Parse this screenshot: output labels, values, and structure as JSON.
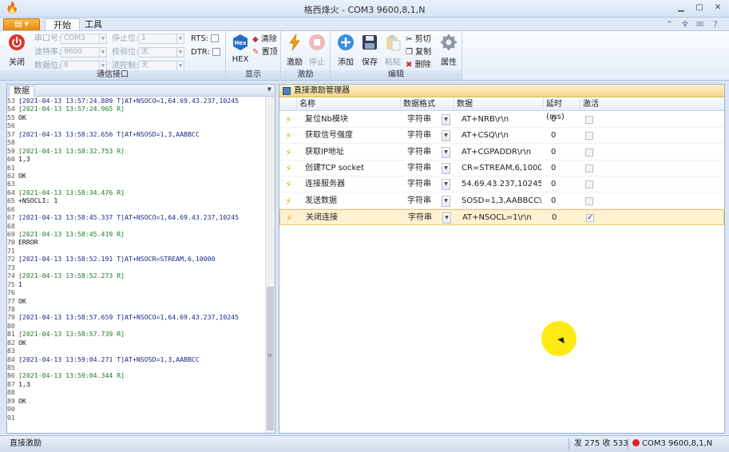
{
  "window": {
    "title": "格西烽火 - COM3  9600,8,1,N",
    "app_icon": "flame-icon"
  },
  "tabs": {
    "app_menu_icon": "app-menu-icon",
    "start": "开始",
    "tools": "工具"
  },
  "ribbon": {
    "close_label": "关闭",
    "serial": {
      "group_label": "通信接口",
      "port_label": "串口号:",
      "port_value": "COM3",
      "baud_label": "波特率:",
      "baud_value": "9600",
      "databits_label": "数据位:",
      "databits_value": "8",
      "stopbits_label": "停止位:",
      "stopbits_value": "1",
      "parity_label": "校验位:",
      "parity_value": "无",
      "flow_label": "流控制:",
      "flow_value": "无",
      "rts_label": "RTS:",
      "dtr_label": "DTR:"
    },
    "display": {
      "group_label": "显示",
      "hex_label": "HEX",
      "hex_icon_text": "Hex",
      "clear_label": "清除",
      "top_label": "置顶"
    },
    "stimulus": {
      "group_label": "激励",
      "fire_label": "激励",
      "stop_label": "停止"
    },
    "edit": {
      "group_label": "编辑",
      "add_label": "添加",
      "save_label": "保存",
      "paste_label": "粘贴",
      "cut_label": "剪切",
      "copy_label": "复制",
      "delete_label": "删除",
      "props_label": "属性"
    }
  },
  "left_panel": {
    "tab_label": "数据",
    "lines": [
      {
        "n": "53",
        "t": "tx",
        "text": "[2021-04-13 13:57:24.889 T]AT+NSOCO=1,64.69.43.237,10245"
      },
      {
        "n": "54",
        "t": "rx",
        "text": "[2021-04-13 13:57:24.965 R]"
      },
      {
        "n": "55",
        "t": "plain",
        "text": "OK"
      },
      {
        "n": "56",
        "t": "plain",
        "text": ""
      },
      {
        "n": "57",
        "t": "tx",
        "text": "[2021-04-13 13:58:32.656 T]AT+NSOSD=1,3,AABBCC"
      },
      {
        "n": "58",
        "t": "plain",
        "text": ""
      },
      {
        "n": "59",
        "t": "rx",
        "text": "[2021-04-13 13:58:32.753 R]"
      },
      {
        "n": "60",
        "t": "plain",
        "text": "1,3"
      },
      {
        "n": "61",
        "t": "plain",
        "text": ""
      },
      {
        "n": "62",
        "t": "plain",
        "text": "OK"
      },
      {
        "n": "63",
        "t": "plain",
        "text": ""
      },
      {
        "n": "64",
        "t": "rx",
        "text": "[2021-04-13 13:58:34.476 R]"
      },
      {
        "n": "65",
        "t": "plain",
        "text": "+NSOCLI: 1"
      },
      {
        "n": "66",
        "t": "plain",
        "text": ""
      },
      {
        "n": "67",
        "t": "tx",
        "text": "[2021-04-13 13:58:45.337 T]AT+NSOCO=1,64.69.43.237,10245"
      },
      {
        "n": "68",
        "t": "plain",
        "text": ""
      },
      {
        "n": "69",
        "t": "rx",
        "text": "[2021-04-13 13:58:45.419 R]"
      },
      {
        "n": "70",
        "t": "plain",
        "text": "ERROR"
      },
      {
        "n": "71",
        "t": "plain",
        "text": ""
      },
      {
        "n": "72",
        "t": "tx",
        "text": "[2021-04-13 13:58:52.191 T]AT+NSOCR=STREAM,6,10000"
      },
      {
        "n": "73",
        "t": "plain",
        "text": ""
      },
      {
        "n": "74",
        "t": "rx",
        "text": "[2021-04-13 13:58:52.273 R]"
      },
      {
        "n": "75",
        "t": "plain",
        "text": "1"
      },
      {
        "n": "76",
        "t": "plain",
        "text": ""
      },
      {
        "n": "77",
        "t": "plain",
        "text": "OK"
      },
      {
        "n": "78",
        "t": "plain",
        "text": ""
      },
      {
        "n": "79",
        "t": "tx",
        "text": "[2021-04-13 13:58:57.659 T]AT+NSOCO=1,64.69.43.237,10245"
      },
      {
        "n": "80",
        "t": "plain",
        "text": ""
      },
      {
        "n": "81",
        "t": "rx",
        "text": "[2021-04-13 13:58:57.739 R]"
      },
      {
        "n": "82",
        "t": "plain",
        "text": "OK"
      },
      {
        "n": "83",
        "t": "plain",
        "text": ""
      },
      {
        "n": "84",
        "t": "tx",
        "text": "[2021-04-13 13:59:04.271 T]AT+NSOSD=1,3,AABBCC"
      },
      {
        "n": "85",
        "t": "plain",
        "text": ""
      },
      {
        "n": "86",
        "t": "rx",
        "text": "[2021-04-13 13:59:04.344 R]"
      },
      {
        "n": "87",
        "t": "plain",
        "text": "1,3"
      },
      {
        "n": "88",
        "t": "plain",
        "text": ""
      },
      {
        "n": "89",
        "t": "plain",
        "text": "OK"
      },
      {
        "n": "90",
        "t": "plain",
        "text": ""
      },
      {
        "n": "91",
        "t": "plain",
        "text": ""
      }
    ]
  },
  "right_panel": {
    "title": "直接激励管理器",
    "columns": {
      "name": "名称",
      "format": "数据格式",
      "data": "数据",
      "delay": "延时(ms)",
      "activate": "激活"
    },
    "rows": [
      {
        "name": "复位Nb模块",
        "format": "字符串",
        "data": "AT+NRB\\r\\n",
        "delay": "0",
        "active": false
      },
      {
        "name": "获取信号强度",
        "format": "字符串",
        "data": "AT+CSQ\\r\\n",
        "delay": "0",
        "active": false
      },
      {
        "name": "获取IP地址",
        "format": "字符串",
        "data": "AT+CGPADDR\\r\\n",
        "delay": "0",
        "active": false
      },
      {
        "name": "创建TCP socket",
        "format": "字符串",
        "data": "CR=STREAM,6,10000\\r",
        "delay": "0",
        "active": false
      },
      {
        "name": "连接服务器",
        "format": "字符串",
        "data": "54.69.43.237,10245\\r\\n",
        "delay": "0",
        "active": false
      },
      {
        "name": "发送数据",
        "format": "字符串",
        "data": "SOSD=1,3,AABBCC\\r\\n",
        "delay": "0",
        "active": false
      },
      {
        "name": "关闭连接",
        "format": "字符串",
        "data": "AT+NSOCL=1\\r\\n",
        "delay": "0",
        "active": true
      }
    ]
  },
  "status": {
    "left": "直接激励",
    "counters": "发 275  收 533",
    "port": "COM3  9600,8,1,N"
  }
}
